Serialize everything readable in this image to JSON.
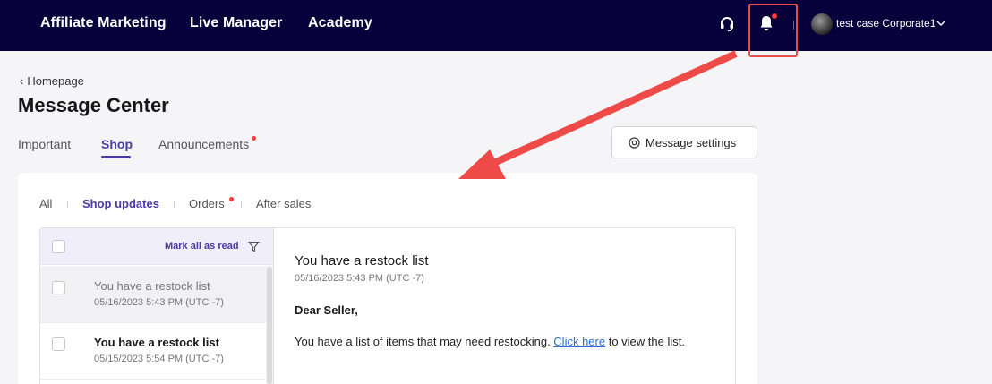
{
  "nav": {
    "items": [
      "Affiliate Marketing",
      "Live Manager",
      "Academy"
    ],
    "account_name": "test case Corporate1",
    "icons": {
      "support": "headset-icon",
      "notifications": "bell-icon",
      "account_menu": "chevron-down-icon"
    },
    "notification_dot_color": "#ff3a3a"
  },
  "breadcrumb": {
    "label": "Homepage"
  },
  "page": {
    "title": "Message Center"
  },
  "tabs": [
    {
      "label": "Important",
      "active": false,
      "unread_dot": false
    },
    {
      "label": "Shop",
      "active": true,
      "unread_dot": false
    },
    {
      "label": "Announcements",
      "active": false,
      "unread_dot": true
    }
  ],
  "settings_button": {
    "label": "Message settings",
    "icon": "gear-icon"
  },
  "subtabs": [
    {
      "label": "All",
      "active": false,
      "unread_dot": false
    },
    {
      "label": "Shop updates",
      "active": true,
      "unread_dot": false
    },
    {
      "label": "Orders",
      "active": false,
      "unread_dot": true
    },
    {
      "label": "After sales",
      "active": false,
      "unread_dot": false
    }
  ],
  "list": {
    "mark_all_label": "Mark all as read",
    "filter_icon": "filter-icon",
    "messages": [
      {
        "title": "You have a restock list",
        "time": "05/16/2023 5:43 PM (UTC -7)",
        "read": true,
        "selected": true
      },
      {
        "title": "You have a restock list",
        "time": "05/15/2023 5:54 PM (UTC -7)",
        "read": false,
        "selected": false
      }
    ]
  },
  "detail": {
    "title": "You have a restock list",
    "time": "05/16/2023 5:43 PM (UTC -7)",
    "greeting": "Dear Seller,",
    "body_before": "You have a list of items that may need restocking. ",
    "link_text": "Click here",
    "body_after": " to view the list."
  },
  "colors": {
    "topbar": "#07003a",
    "accent": "#4a3aa5",
    "annotation": "#e94b49",
    "link": "#2a6fd6"
  }
}
